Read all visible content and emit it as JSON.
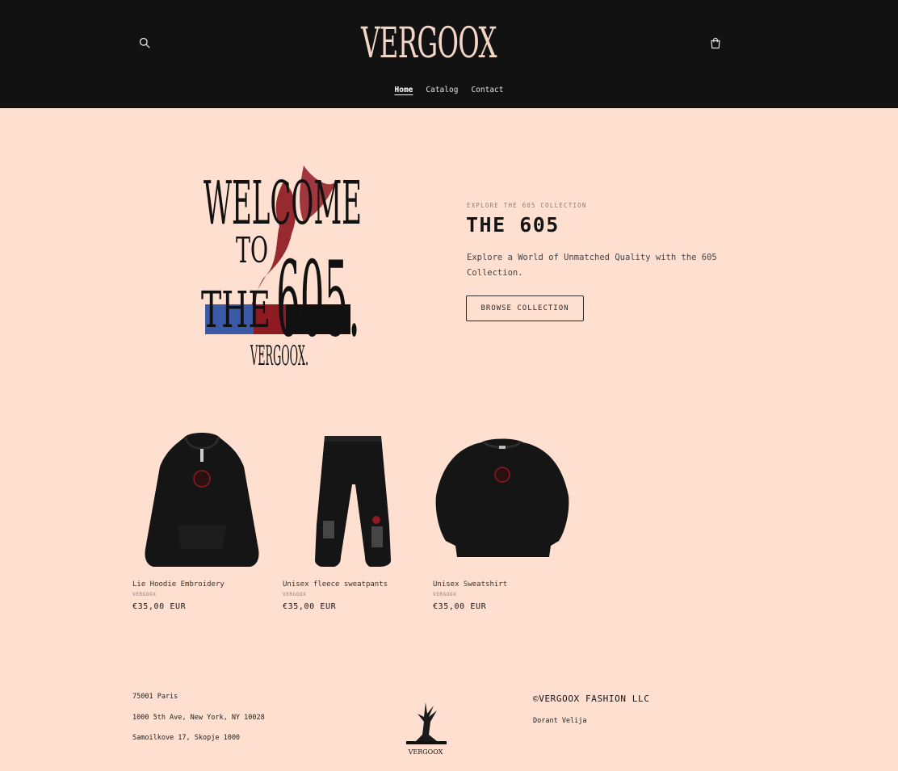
{
  "header": {
    "logo_text": "VERGOOX",
    "search_icon": "search-icon",
    "cart_icon": "cart-icon",
    "nav": [
      {
        "label": "Home",
        "active": true
      },
      {
        "label": "Catalog",
        "active": false
      },
      {
        "label": "Contact",
        "active": false
      }
    ]
  },
  "hero": {
    "art_text": {
      "line1": "WELCOME",
      "line2": "TO",
      "line3": "THE",
      "line4": "605.",
      "brand": "VERGOOX."
    },
    "eyebrow": "EXPLORE THE 605 COLLECTION",
    "title": "THE 605",
    "description": "Explore a World of Unmatched Quality with the 605 Collection.",
    "button": "BROWSE COLLECTION"
  },
  "products": [
    {
      "name": "Lie Hoodie Embroidery",
      "vendor": "VERGOOX",
      "price": "€35,00 EUR"
    },
    {
      "name": "Unisex fleece sweatpants",
      "vendor": "VERGOOX",
      "price": "€35,00 EUR"
    },
    {
      "name": "Unisex Sweatshirt",
      "vendor": "VERGOOX",
      "price": "€35,00 EUR"
    }
  ],
  "footer": {
    "addresses": [
      "75001 Paris",
      "1000 5th Ave, New York, NY 10028",
      "Samoilkove 17, Skopje 1000"
    ],
    "logo_text": "VERGOOX",
    "copyright": "©VERGOOX FASHION LLC",
    "owner": "Dorant Velija"
  },
  "colors": {
    "background": "#ffdfcf",
    "header": "#121212",
    "logo": "#f3d6c6",
    "accent_red": "#8e1a22",
    "accent_blue": "#3a5aa8"
  }
}
